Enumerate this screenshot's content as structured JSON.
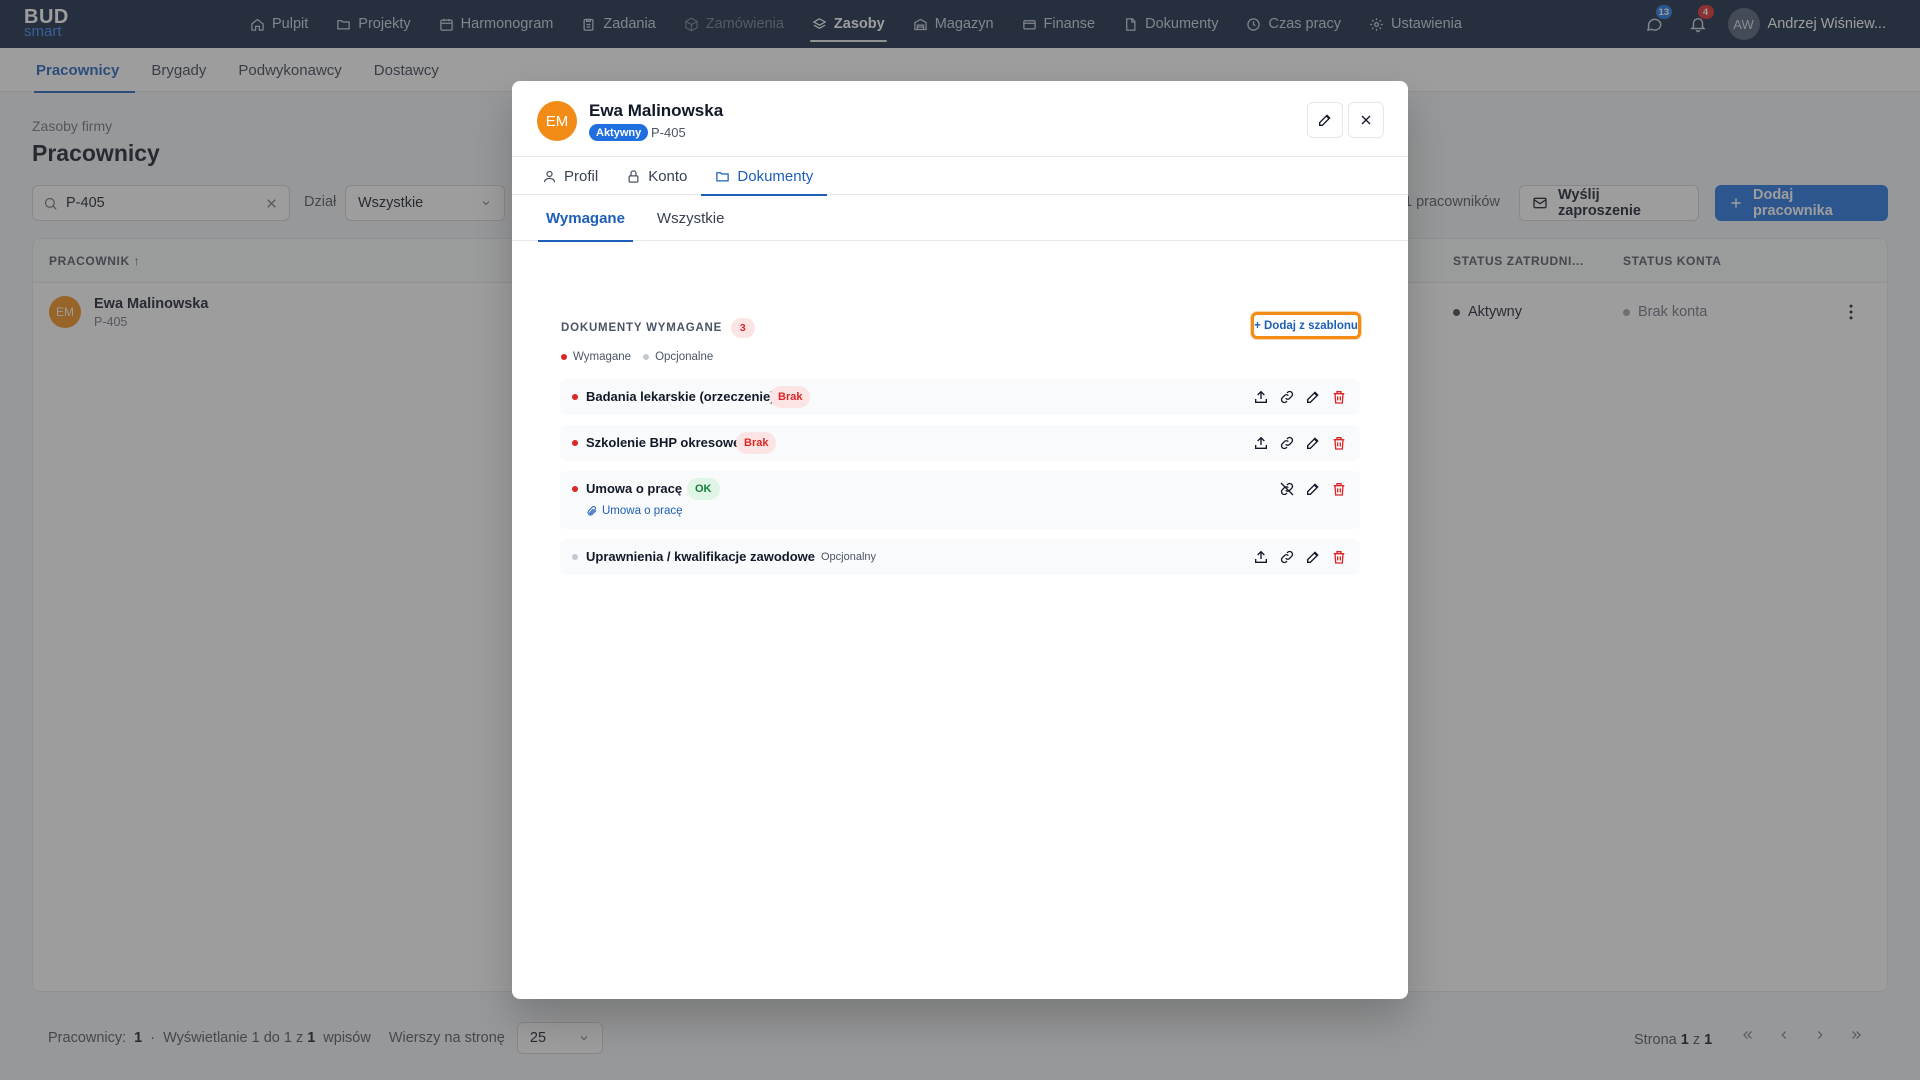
{
  "app": {
    "logo_line1": "BUD",
    "logo_line2": "smart"
  },
  "nav": {
    "items": [
      {
        "label": "Pulpit",
        "icon": "home-icon"
      },
      {
        "label": "Projekty",
        "icon": "folder-icon"
      },
      {
        "label": "Harmonogram",
        "icon": "calendar-icon"
      },
      {
        "label": "Zadania",
        "icon": "clipboard-icon"
      },
      {
        "label": "Zamówienia",
        "icon": "package-icon"
      },
      {
        "label": "Zasoby",
        "icon": "layers-icon"
      },
      {
        "label": "Magazyn",
        "icon": "warehouse-icon"
      },
      {
        "label": "Finanse",
        "icon": "card-icon"
      },
      {
        "label": "Dokumenty",
        "icon": "document-icon"
      },
      {
        "label": "Czas pracy",
        "icon": "clock-icon"
      },
      {
        "label": "Ustawienia",
        "icon": "gear-icon"
      }
    ],
    "messages_count": "13",
    "notifications_count": "4",
    "user_initials": "AW",
    "user_name": "Andrzej Wiśniew..."
  },
  "subtabs": [
    "Pracownicy",
    "Brygady",
    "Podwykonawcy",
    "Dostawcy"
  ],
  "page": {
    "breadcrumb": "Zasoby firmy",
    "title": "Pracownicy",
    "search_value": "P-405",
    "dept_label": "Dział",
    "dept_value": "Wszystkie",
    "count_text": "1 pracowników",
    "invite_label": "Wyślij zaproszenie",
    "add_label": "Dodaj pracownika"
  },
  "table": {
    "headers": {
      "employee": "PRACOWNIK",
      "emp_status": "STATUS ZATRUDNI...",
      "acc_status": "STATUS KONTA"
    },
    "rows": [
      {
        "initials": "EM",
        "name": "Ewa Malinowska",
        "code": "P-405",
        "status": "Aktywny",
        "account": "Brak konta"
      }
    ]
  },
  "footer": {
    "employees_label": "Pracownicy:",
    "employees_count": "1",
    "sep": "·",
    "showing_prefix": "Wyświetlanie 1 do 1 z",
    "showing_total": "1",
    "showing_suffix": "wpisów",
    "rows_label": "Wierszy na stronę",
    "rows_value": "25",
    "page_prefix": "Strona",
    "page_current": "1",
    "page_of": "z",
    "page_total": "1"
  },
  "modal": {
    "initials": "EM",
    "name": "Ewa Malinowska",
    "badge": "Aktywny",
    "code": "P-405",
    "tabs": [
      {
        "label": "Profil",
        "icon": "user-icon"
      },
      {
        "label": "Konto",
        "icon": "lock-icon"
      },
      {
        "label": "Dokumenty",
        "icon": "folder-icon"
      }
    ],
    "doc_tabs": [
      "Wymagane",
      "Wszystkie"
    ],
    "section_title": "DOKUMENTY WYMAGANE",
    "section_count": "3",
    "add_template": "+ Dodaj z szablonu",
    "legend_required": "Wymagane",
    "legend_optional": "Opcjonalne",
    "documents": [
      {
        "name": "Badania lekarskie (orzeczenie)",
        "status": "Brak"
      },
      {
        "name": "Szkolenie BHP okresowe",
        "status": "Brak"
      },
      {
        "name": "Umowa o pracę",
        "status": "OK",
        "attachment": "Umowa o pracę"
      },
      {
        "name": "Uprawnienia / kwalifikacje zawodowe",
        "status": "Opcjonalny"
      }
    ]
  },
  "colors": {
    "nav_bg": "#0f2340",
    "accent": "#1f6fe0",
    "avatar_orange": "#f28c16",
    "danger": "#dc2626",
    "success": "#15803d"
  }
}
